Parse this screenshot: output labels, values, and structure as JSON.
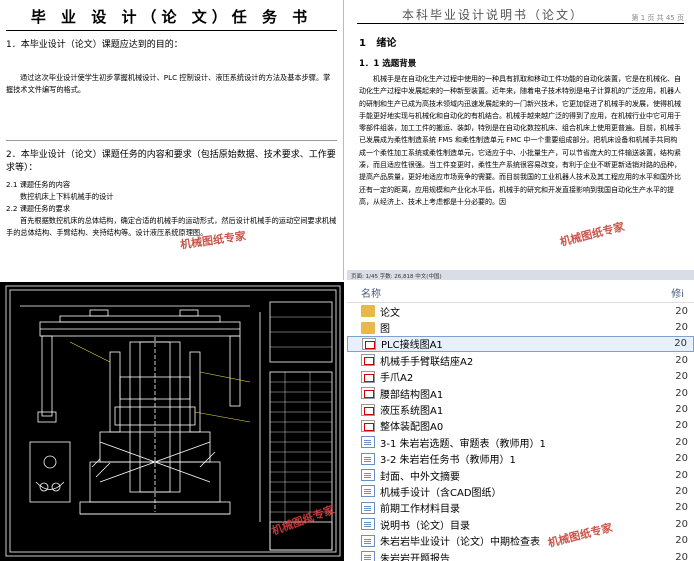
{
  "task_doc": {
    "title": "毕 业 设 计（论 文）任 务 书",
    "sec1_head": "1．本毕业设计（论文）课题应达到的目的：",
    "sec1_body": "通过这次毕业设计使学生初步掌握机械设计、PLC 控制设计、液压系统设计的方法及基本步骤。掌握技术文件编写的格式。",
    "sec2_head": "2．本毕业设计（论文）课题任务的内容和要求（包括原始数据、技术要求、工作要求等）：",
    "sec21": "2.1 课题任务的内容",
    "sec21_body": "数控机床上下料机械手的设计",
    "sec22": "2.2 课题任务的要求",
    "sec22_body": "首先根据数控机床的总体结构，确定合适的机械手的运动形式，然后设计机械手的运动空间要求机械手的总体结构、手臂结构、夹持结构等。设计液压系统原理图。"
  },
  "manual_doc": {
    "title": "本科毕业设计说明书（论文）",
    "page": "第 1 页  共 45 页",
    "h1_num": "1",
    "h1": "绪论",
    "h2": "1．1  选题背景",
    "p1": "机械手是在自动化生产过程中使用的一种具有抓取和移动工件功能的自动化装置，它是在机械化、自动化生产过程中发展起来的一种新型装置。近年来，随着电子技术特别是电子计算机的广泛应用，机器人的研制和生产已成为高技术领域内迅速发展起来的一门新兴技术，它更加促进了机械手的发展，使得机械手能更好地实现与机械化和自动化的有机结合。机械手越来越广泛的得到了应用，在机械行业中它可用于零部件组装，加工工件的搬运、装卸，特别是在自动化数控机床、组合机床上使用更普遍。目前，机械手已发展成为柔性制造系统 FMS 和柔性制造单元 FMC 中一个重要组成部分。把机床设备和机械手共同构成一个柔性加工系统或柔性制造单元，它适应于中、小批量生产，可以节省庞大的工件输送装置，结构紧凑，而且适应性很强。当工件变更时，柔性生产系统很容易改变，有利于企业不断更新适销对路的品种，提高产品质量，更好地适应市场竞争的需要。而目前我国的工业机器人技术及其工程应用的水平和国外比还有一定的距离，应用规模和产业化水平低，机械手的研究和开发直接影响到我国自动化生产水平的提高，从经济上、技术上考虑都是十分必要的。因",
    "status": "页面: 1/45   字数: 26,818   中文(中国)"
  },
  "file_list": {
    "col_name": "名称",
    "col_date": "修i",
    "items": [
      {
        "name": "论文",
        "type": "folder",
        "date": "20"
      },
      {
        "name": "图",
        "type": "folder",
        "date": "20"
      },
      {
        "name": "PLC接线图A1",
        "type": "cad",
        "date": "20"
      },
      {
        "name": "机械手手臂联结座A2",
        "type": "cad",
        "date": "20"
      },
      {
        "name": "手爪A2",
        "type": "cad",
        "date": "20"
      },
      {
        "name": "腰部结构图A1",
        "type": "cad",
        "date": "20"
      },
      {
        "name": "液压系统图A1",
        "type": "cad",
        "date": "20"
      },
      {
        "name": "整体装配图A0",
        "type": "cad",
        "date": "20"
      },
      {
        "name": "3-1   朱岩岩选题、审题表（教师用）1",
        "type": "doc",
        "date": "20"
      },
      {
        "name": "3-2   朱岩岩任务书（教师用）1",
        "type": "doc",
        "date": "20"
      },
      {
        "name": "封面、中外文摘要",
        "type": "doc",
        "date": "20"
      },
      {
        "name": "机械手设计（含CAD图纸）",
        "type": "doc",
        "date": "20"
      },
      {
        "name": "前期工作材料目录",
        "type": "doc",
        "date": "20"
      },
      {
        "name": "说明书（论文）目录",
        "type": "doc",
        "date": "20"
      },
      {
        "name": "朱岩岩毕业设计（论文）中期检查表",
        "type": "doc",
        "date": "20"
      },
      {
        "name": "朱岩岩开题报告",
        "type": "doc",
        "date": "20"
      },
      {
        "name": "朱岩岩外文资料翻译",
        "type": "doc",
        "date": "20"
      }
    ]
  },
  "watermarks": {
    "w1": "机械图纸专家",
    "w2": "机械图纸专家",
    "w3": "机械图纸专家",
    "w4": "机械图纸专家"
  },
  "colors": {
    "watermark": "#c0392b",
    "cad_bg": "#000000",
    "cad_line": "#ffffff",
    "selection": "#e8f1fb"
  }
}
